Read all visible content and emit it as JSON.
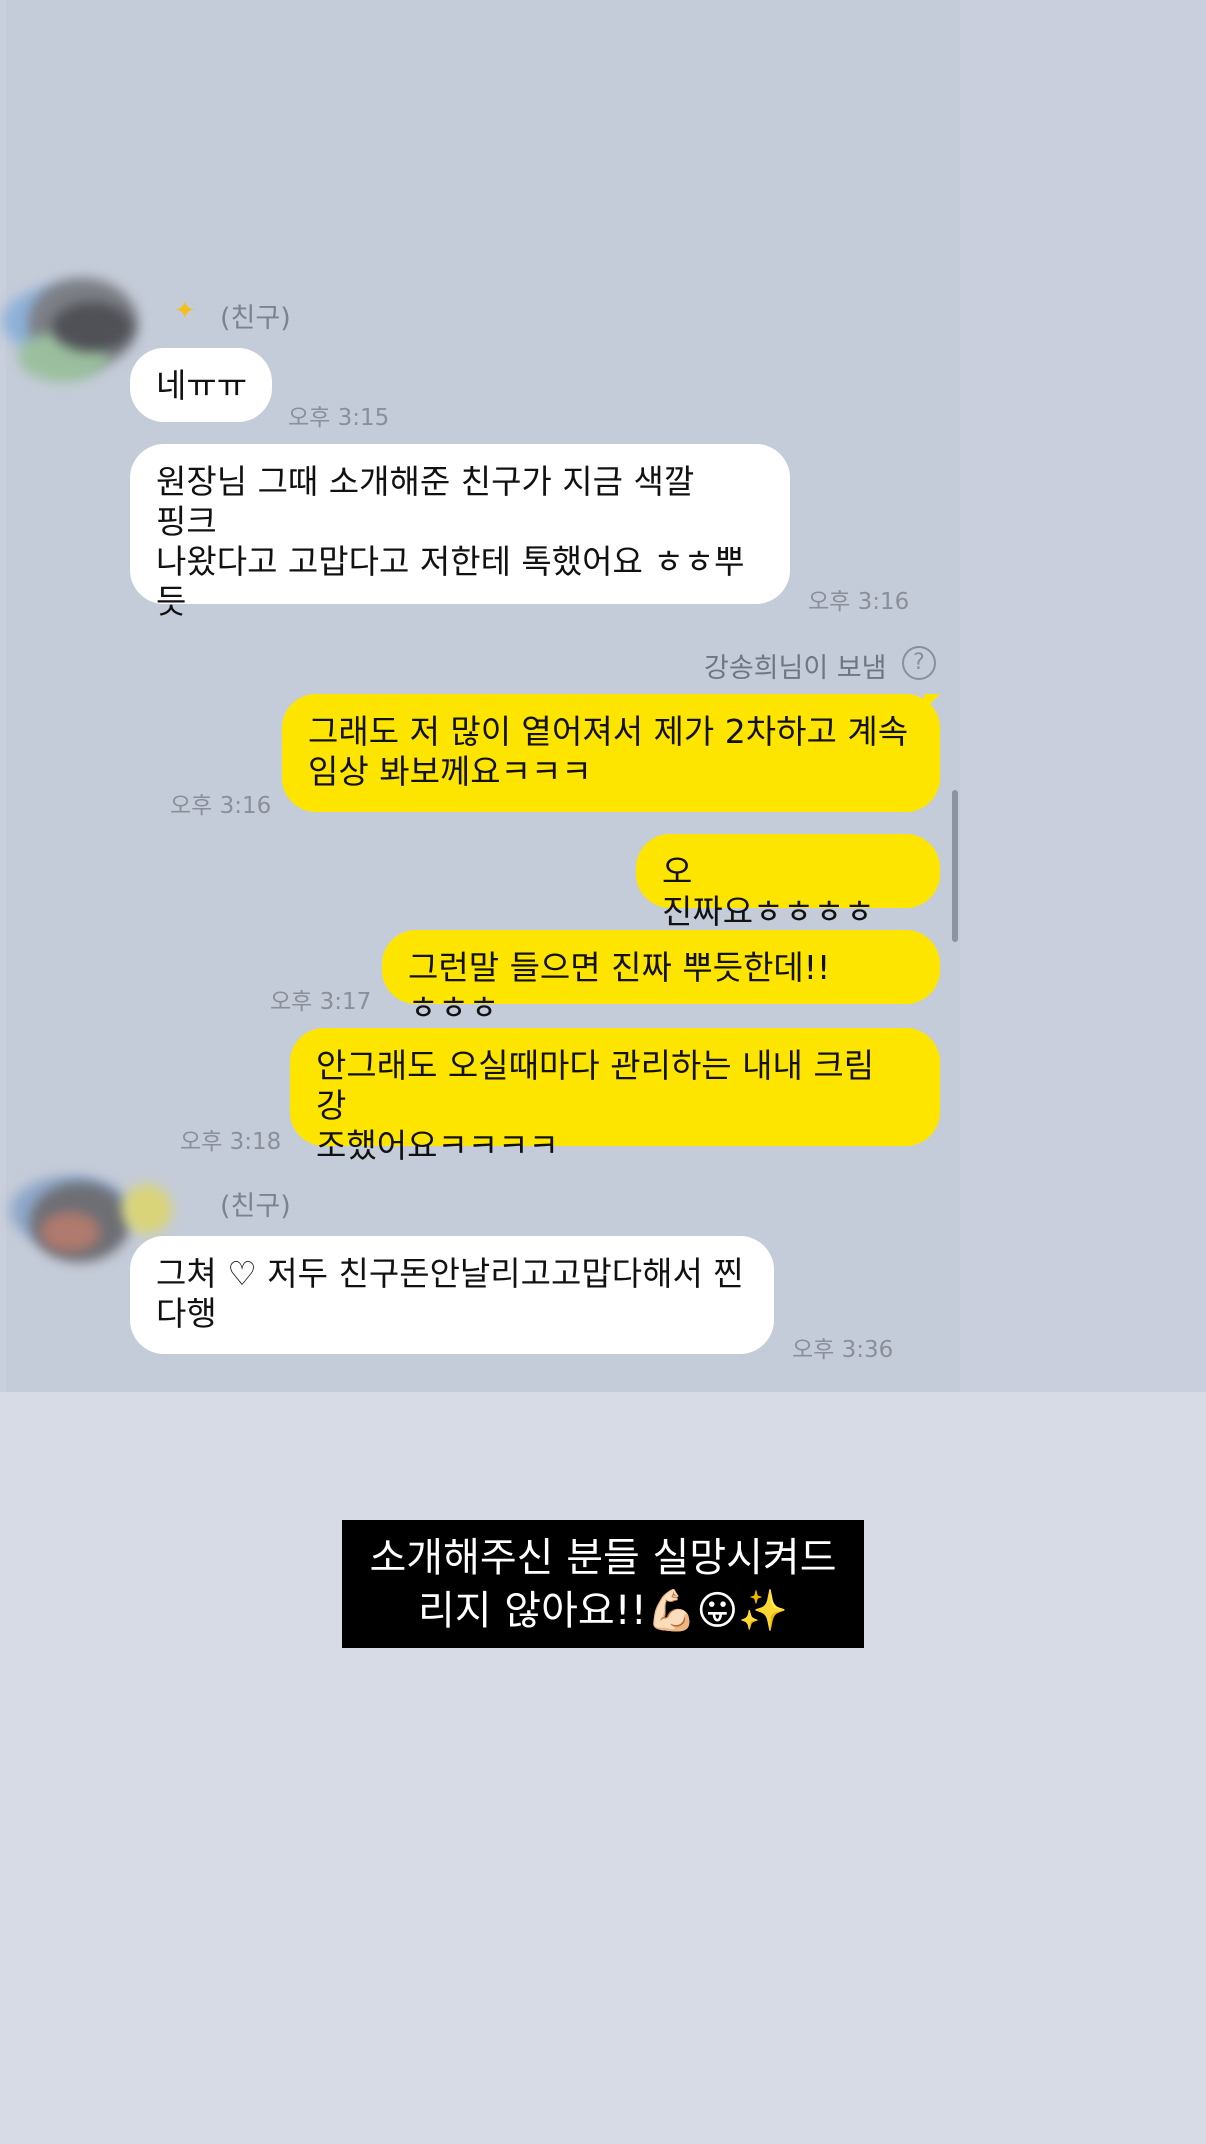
{
  "friend_label": "(친구)",
  "sent_by": {
    "label": "강송희님이 보냄",
    "icon": "help-circle-icon"
  },
  "messages": [
    {
      "text": "네ㅠㅠ",
      "time": "오후 3:15"
    },
    {
      "text": "원장님 그때 소개해준 친구가 지금 색깔 핑크\n 나왔다고 고맙다고 저한테 톡했어요 ㅎㅎ뿌\n듯",
      "time": "오후 3:16"
    },
    {
      "text": "그래도 저 많이 옅어져서 제가 2차하고 계속\n임상 봐보께요ㅋㅋㅋ",
      "time": "오후 3:16"
    },
    {
      "text": "오 진짜요ㅎㅎㅎㅎ",
      "time": ""
    },
    {
      "text": "그런말 들으면 진짜 뿌듯한데!!ㅎㅎㅎ",
      "time": "오후 3:17"
    },
    {
      "text": "안그래도 오실때마다 관리하는 내내 크림 강\n조했어요ㅋㅋㅋㅋ",
      "time": "오후 3:18"
    },
    {
      "text": "그쳐 ♡ 저두 친구돈안날리고고맙다해서 찐\n다행",
      "time": "오후 3:36"
    }
  ],
  "caption": {
    "line1": "소개해주신 분들 실망시켜드",
    "line2": "리지 않아요!!💪🏻😛✨"
  },
  "colors": {
    "outgoing_bubble": "#fee500",
    "incoming_bubble": "#ffffff",
    "chat_background": "#c5ccd9"
  }
}
